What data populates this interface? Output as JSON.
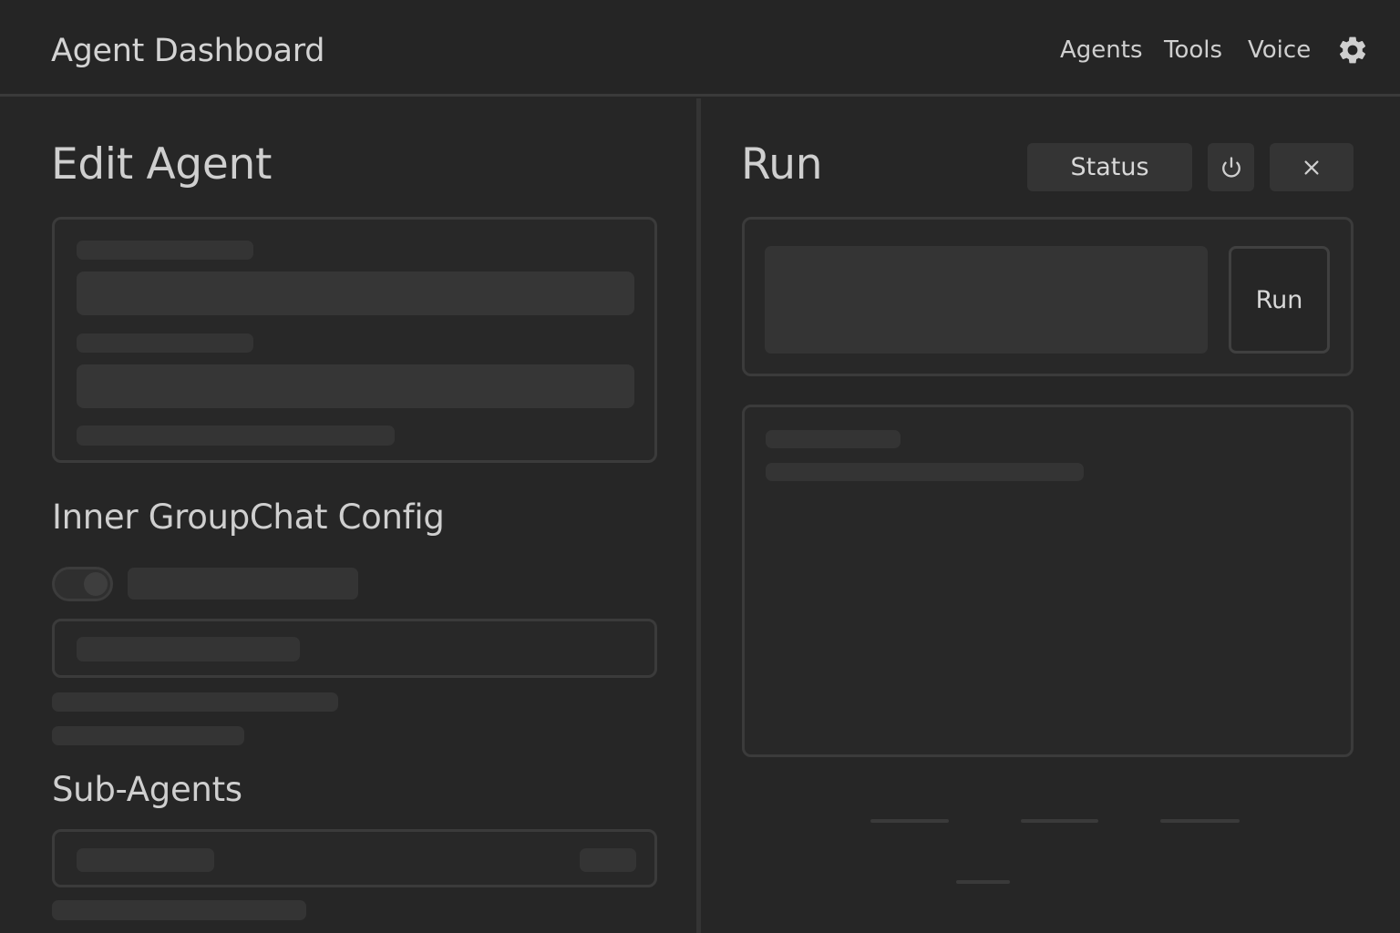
{
  "header": {
    "title": "Agent Dashboard",
    "nav": [
      "Agents",
      "Tools",
      "Voice"
    ],
    "settings_icon": "gear-icon"
  },
  "left": {
    "title": "Edit Agent",
    "groupchat_title": "Inner GroupChat Config",
    "subagents_title": "Sub-Agents"
  },
  "right": {
    "title": "Run",
    "status_label": "Status",
    "power_icon": "power-icon",
    "close_icon": "close-icon",
    "run_label": "Run"
  },
  "colors": {
    "background": "#262626",
    "panel_border": "#3b3b3b",
    "placeholder": "#343434",
    "text": "#d0d0d0"
  }
}
